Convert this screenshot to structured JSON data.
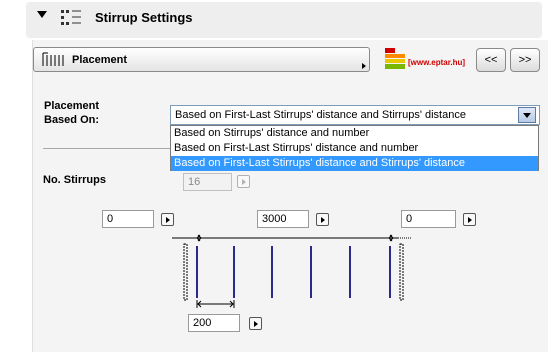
{
  "header": {
    "title": "Stirrup Settings"
  },
  "placement": {
    "selected": "Placement"
  },
  "logo": {
    "text": "[www.eptar.hu]"
  },
  "nav": {
    "prev_label": "<<",
    "next_label": ">>"
  },
  "placement_based_on": {
    "label_line1": "Placement",
    "label_line2": "Based On:",
    "value": "Based on First-Last Stirrups' distance and Stirrups' distance",
    "options": [
      "Based on Stirrups' distance and number",
      "Based on First-Last Stirrups' distance and number",
      "Based on First-Last Stirrups' distance and Stirrups' distance"
    ],
    "selected_index": 2
  },
  "stirrups": {
    "label": "No. Stirrups",
    "value": "16"
  },
  "distances": {
    "start": "0",
    "total": "3000",
    "end": "0",
    "spacing": "200"
  },
  "colors": {
    "selection": "#3399ff",
    "logo_red": "#d00000",
    "logo_orange": "#ff8a00",
    "logo_yellow": "#e8c800",
    "logo_green": "#7ab800"
  }
}
